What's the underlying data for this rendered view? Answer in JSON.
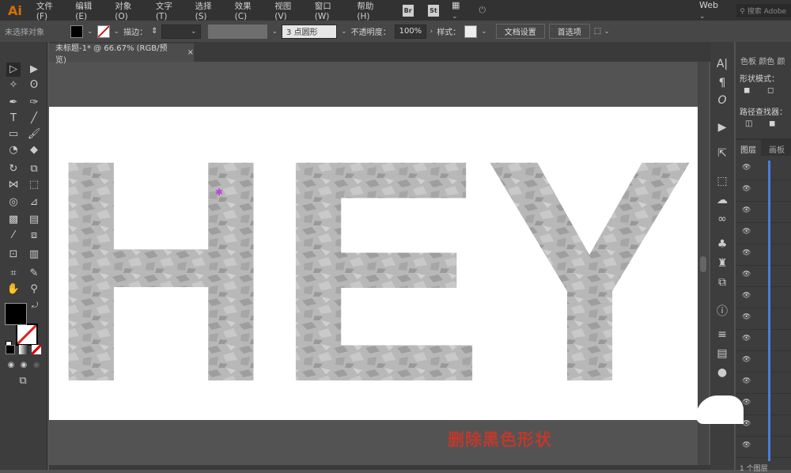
{
  "app": {
    "logo": "Ai",
    "menus": [
      "文件(F)",
      "编辑(E)",
      "对象(O)",
      "文字(T)",
      "选择(S)",
      "效果(C)",
      "视图(V)",
      "窗口(W)",
      "帮助(H)"
    ],
    "bridge": "Br",
    "stock": "St",
    "workspace": "Web",
    "search_placeholder": "搜索 Adobe"
  },
  "control": {
    "selection": "未选择对象",
    "stroke_label": "描边：",
    "brush": "3 点圆形",
    "opacity_label": "不透明度：",
    "opacity": "100%",
    "style_label": "样式：",
    "doc_setup": "文档设置",
    "prefs": "首选项"
  },
  "tab": {
    "title": "未标题-1* @ 66.67% (RGB/预览)",
    "close": "×"
  },
  "artwork": {
    "text": "HEY",
    "fill": "#b4b4b4"
  },
  "panel": {
    "tabs": [
      "色板",
      "颜色",
      "颜"
    ],
    "shape_modes": "形状模式：",
    "pathfinder": "路径查找器：",
    "layer_tabs": [
      "图层",
      "画板"
    ],
    "layer_count": "1 个图层"
  },
  "caption": "删除黑色形状",
  "colors": {
    "caption": "#c0392b",
    "layer_line": "#4a7de0",
    "logo": "#ff7c00"
  }
}
